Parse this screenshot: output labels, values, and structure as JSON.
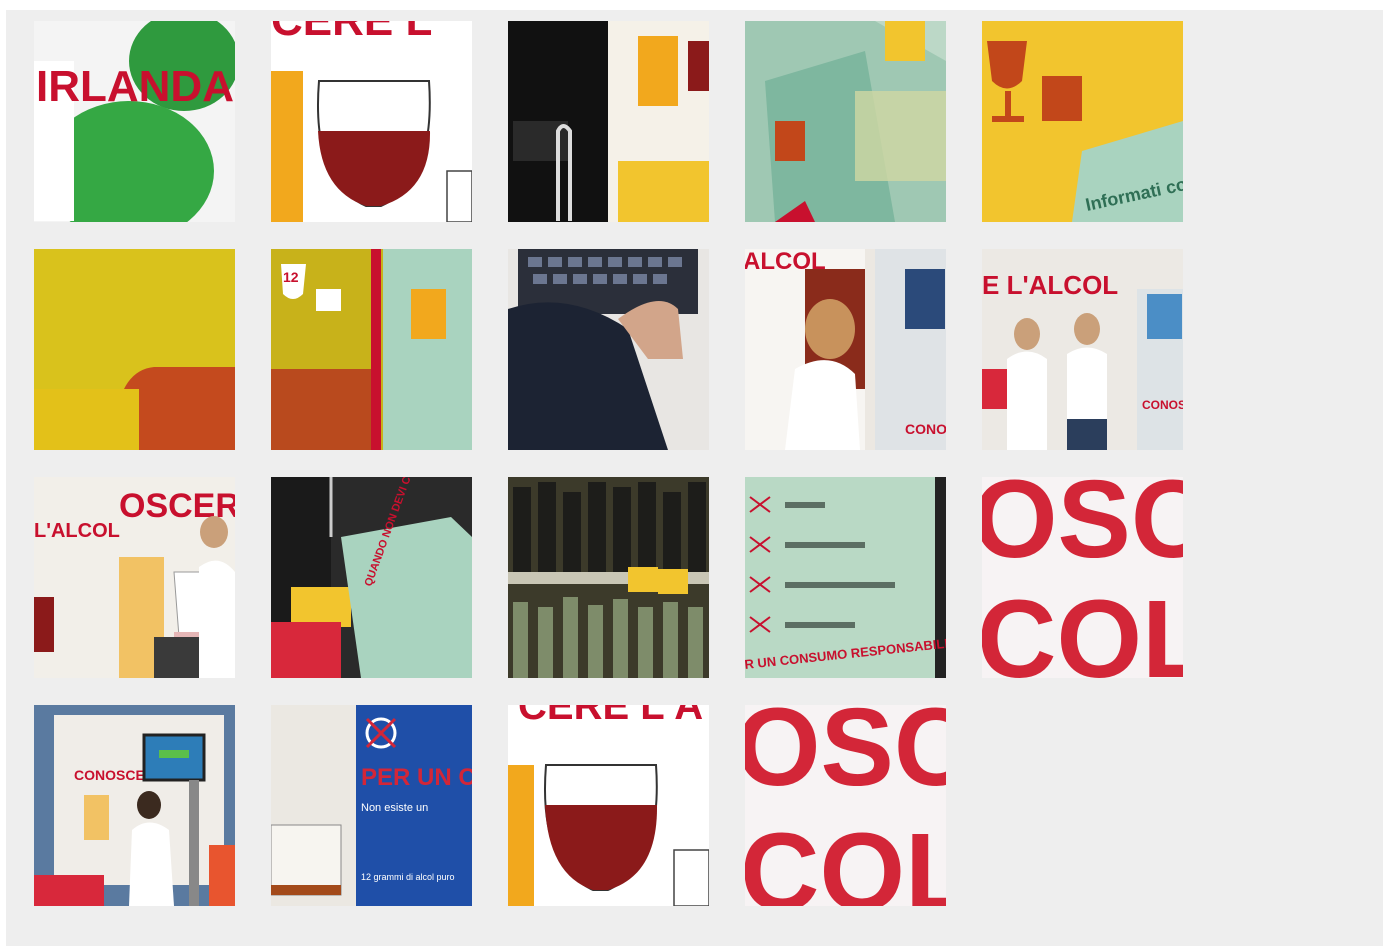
{
  "gallery": {
    "thumbnails": [
      {
        "label": "IRLANDA"
      },
      {
        "label": "CERE L"
      },
      {
        "label": ""
      },
      {
        "label": ""
      },
      {
        "label": "Informati con"
      },
      {
        "label": ""
      },
      {
        "label": "12"
      },
      {
        "label": ""
      },
      {
        "label": "ALCOL"
      },
      {
        "label": "E L'ALCOL"
      },
      {
        "label": "OSCERE",
        "sub": "L'ALCOL"
      },
      {
        "label": "QUANDO NON DEVI CONSUMARE ALCOL"
      },
      {
        "label": ""
      },
      {
        "label": "R UN CONSUMO RESPONSABILE"
      },
      {
        "label": "OSC",
        "sub": "COL"
      },
      {
        "label": "CONOSCERE L"
      },
      {
        "label": "PER UN C",
        "sub": "Non esiste un",
        "sub2": "12 grammi di alcol puro"
      },
      {
        "label": "CERE L'A"
      },
      {
        "label": "OSC",
        "sub": "COL"
      }
    ]
  },
  "colors": {
    "panel": "#eeeeee",
    "red": "#c8102e",
    "wine": "#8b1a1a",
    "yellow": "#f2c52e",
    "mint": "#a9d3bf",
    "blue": "#1f4fa8"
  }
}
